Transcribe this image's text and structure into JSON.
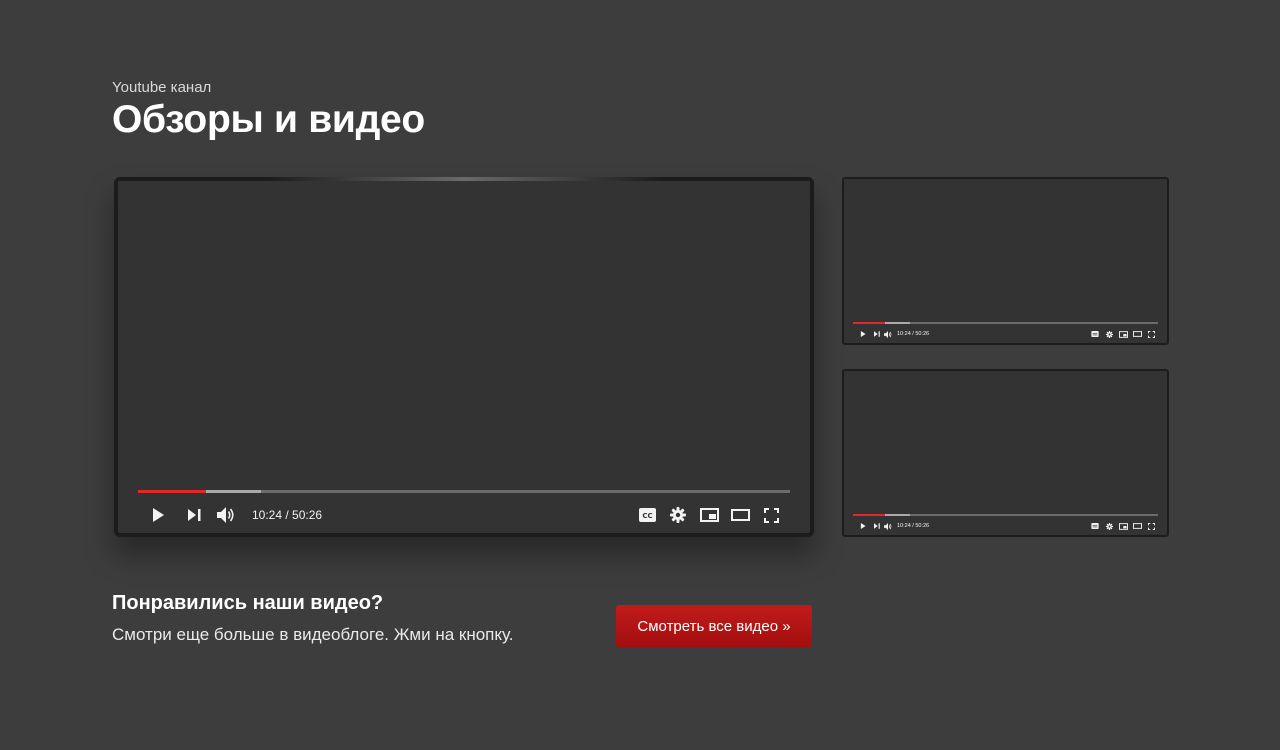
{
  "header": {
    "eyebrow": "Youtube канал",
    "title": "Обзоры и видео"
  },
  "players": [
    {
      "time": "10:24 / 50:26",
      "played_fraction": 0.104,
      "buffered_fraction": 0.188
    },
    {
      "time": "10:24 / 50:26",
      "played_fraction": 0.104,
      "buffered_fraction": 0.188
    },
    {
      "time": "10:24 / 50:26",
      "played_fraction": 0.104,
      "buffered_fraction": 0.188
    }
  ],
  "icons": {
    "play": "play-icon",
    "next": "next-icon",
    "volume": "volume-icon",
    "captions": "captions-icon",
    "settings": "gear-icon",
    "miniplayer": "miniplayer-icon",
    "theater": "theater-icon",
    "fullscreen": "fullscreen-icon"
  },
  "cta": {
    "title": "Понравились наши видео?",
    "text": "Смотри еще больше в видеоблоге. Жми на кнопку.",
    "button_label": "Смотреть все видео »"
  },
  "colors": {
    "background": "#3d3d3d",
    "player": "#333333",
    "progress_played": "#e02828",
    "button": "#b31515"
  }
}
